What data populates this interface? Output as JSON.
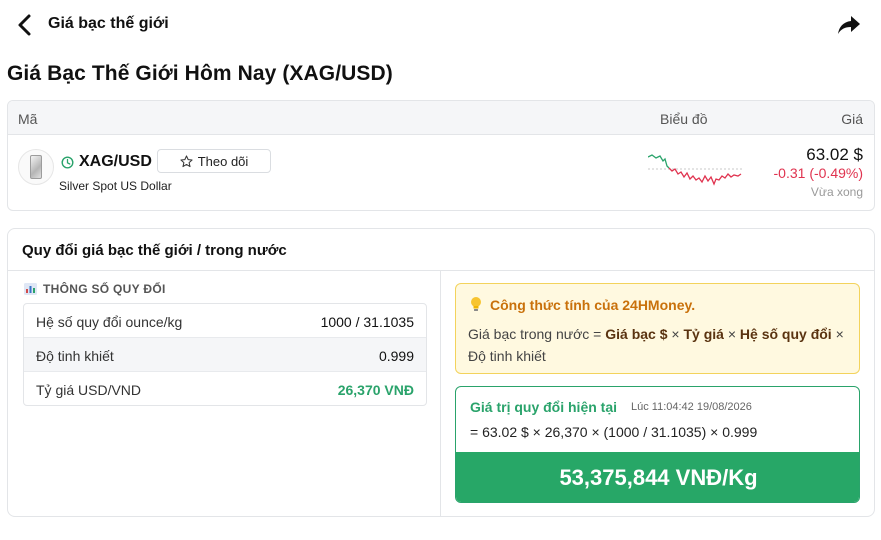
{
  "topbar": {
    "title": "Giá bạc thế giới",
    "back_icon": "chevron-left-icon",
    "share_icon": "share-arrow-icon"
  },
  "page": {
    "title": "Giá Bạc Thế Giới Hôm Nay (XAG/USD)"
  },
  "quote_table": {
    "headers": {
      "code": "Mã",
      "chart": "Biểu đồ",
      "price": "Giá"
    },
    "row": {
      "symbol": "XAG/USD",
      "name": "Silver Spot US Dollar",
      "follow_label": "Theo dõi",
      "price": "63.02 $",
      "change": "-0.31 (-0.49%)",
      "updated": "Vừa xong",
      "status_icon": "clock-icon",
      "colors": {
        "down": "#e0334f",
        "up": "#2aa36b"
      }
    }
  },
  "converter": {
    "title": "Quy đổi giá bạc thế giới / trong nước",
    "params_label": "THÔNG SỐ QUY ĐỔI",
    "params": [
      {
        "label": "Hệ số quy đổi ounce/kg",
        "value": "1000 / 31.1035"
      },
      {
        "label": "Độ tinh khiết",
        "value": "0.999"
      },
      {
        "label": "Tỷ giá USD/VND",
        "value": "26,370 VNĐ"
      }
    ],
    "formula": {
      "title": "Công thức tính của 24HMoney.",
      "prefix": "Giá bạc trong nước = ",
      "term1": "Giá bạc $",
      "op1": " × ",
      "term2": "Tỷ giá",
      "op2": " × ",
      "term3": "Hệ số quy đổi",
      "suffix": " × Độ tinh khiết"
    },
    "result": {
      "title": "Giá trị quy đổi hiện tại",
      "time": "Lúc 11:04:42 19/08/2026",
      "formula": "= 63.02 $ × 26,370 × (1000 / 31.1035) × 0.999",
      "value": "53,375,844 VNĐ/Kg",
      "accent": "#27a767"
    }
  }
}
